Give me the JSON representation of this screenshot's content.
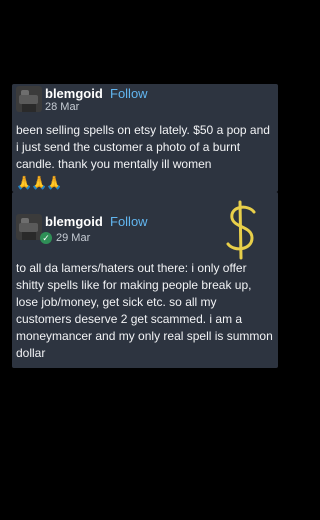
{
  "posts": [
    {
      "username": "blemgoid",
      "follow_label": "Follow",
      "date": "28 Mar",
      "text": "been selling spells on etsy lately. $50 a pop and i just send the customer a photo of a burnt candle. thank you mentally ill women",
      "emoji": "🙏🙏🙏"
    },
    {
      "username": "blemgoid",
      "follow_label": "Follow",
      "date": "29 Mar",
      "badge_icon": "check-badge-icon",
      "text": "to all da lamers/haters out there: i only offer shitty spells like for making people break up, lose job/money, get sick etc. so all my customers deserve 2 get scammed. i am a moneymancer and my only real spell is summon dollar"
    }
  ],
  "colors": {
    "background": "#000000",
    "card": "#2d3440",
    "follow": "#62b6f0",
    "dollar_drawing": "#e8cf4a"
  },
  "icons": [
    "avatar-image",
    "check-badge-icon",
    "dollar-sign-drawing"
  ]
}
